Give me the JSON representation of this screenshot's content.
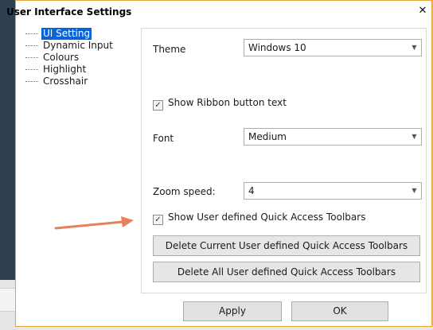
{
  "dialog": {
    "title": "User Interface Settings",
    "close_glyph": "✕"
  },
  "tree": {
    "items": [
      {
        "label": "UI Setting",
        "selected": true
      },
      {
        "label": "Dynamic Input",
        "selected": false
      },
      {
        "label": "Colours",
        "selected": false
      },
      {
        "label": "Highlight",
        "selected": false
      },
      {
        "label": "Crosshair",
        "selected": false
      }
    ]
  },
  "panel": {
    "theme": {
      "label": "Theme",
      "value": "Windows 10"
    },
    "ribbon_text": {
      "label": "Show Ribbon button text",
      "checked": true
    },
    "font": {
      "label": "Font",
      "value": "Medium"
    },
    "zoom": {
      "label": "Zoom speed:",
      "value": "4"
    },
    "quick_access": {
      "label": "Show User defined Quick Access Toolbars",
      "checked": true
    },
    "delete_current_label": "Delete Current User defined Quick Access Toolbars",
    "delete_all_label": "Delete All User defined Quick Access Toolbars"
  },
  "footer": {
    "apply_label": "Apply",
    "ok_label": "OK"
  },
  "icons": {
    "dropdown": "chevron-down-icon",
    "check": "check-icon",
    "close": "close-icon",
    "annotation": "arrow-icon"
  },
  "colors": {
    "accent_border": "#e8a43a",
    "selection": "#0a64d6",
    "annotation_arrow": "#e8805a"
  }
}
